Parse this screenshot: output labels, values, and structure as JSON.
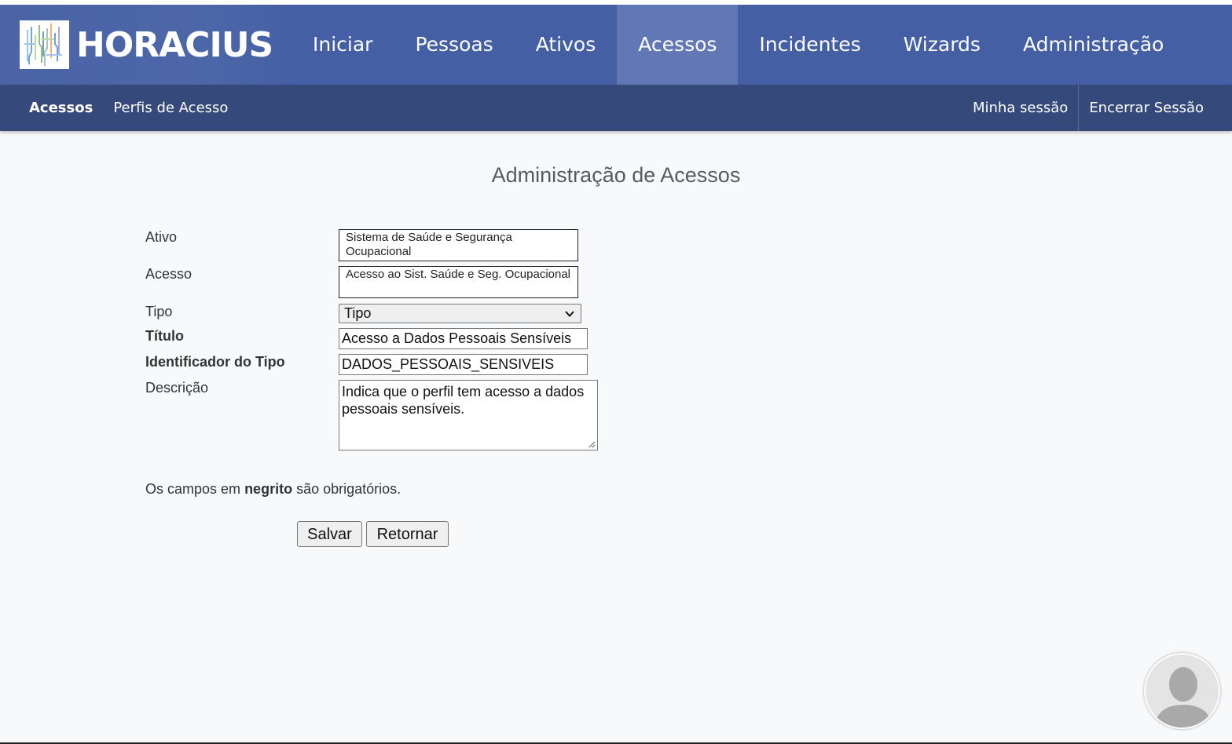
{
  "app": {
    "brand": "HORACIUS"
  },
  "nav": {
    "items": [
      {
        "label": "Iniciar"
      },
      {
        "label": "Pessoas"
      },
      {
        "label": "Ativos"
      },
      {
        "label": "Acessos"
      },
      {
        "label": "Incidentes"
      },
      {
        "label": "Wizards"
      },
      {
        "label": "Administração"
      }
    ],
    "active": "Acessos"
  },
  "subnav": {
    "left": [
      {
        "label": "Acessos"
      },
      {
        "label": "Perfis de Acesso"
      }
    ],
    "right": [
      {
        "label": "Minha sessão"
      },
      {
        "label": "Encerrar Sessão"
      }
    ]
  },
  "page": {
    "title": "Administração de Acessos"
  },
  "form": {
    "ativo_label": "Ativo",
    "ativo_value": "Sistema de Saúde e Segurança Ocupacional",
    "acesso_label": "Acesso",
    "acesso_value": "Acesso ao Sist. Saúde e Seg. Ocupacional",
    "tipo_label": "Tipo",
    "tipo_value": "Tipo",
    "titulo_label": "Título",
    "titulo_value": "Acesso a Dados Pessoais Sensíveis",
    "identificador_label": "Identificador do Tipo",
    "identificador_value": "DADOS_PESSOAIS_SENSIVEIS",
    "descricao_label": "Descrição",
    "descricao_value": "Indica que o perfil tem acesso a dados pessoais sensíveis.",
    "note_prefix": "Os campos em",
    "note_bold": "negrito",
    "note_suffix": "são obrigatórios.",
    "save_label": "Salvar",
    "return_label": "Retornar"
  },
  "colors": {
    "header": "#445fa3",
    "nav_active": "#6277b5",
    "subnav": "#36497b",
    "background": "#f7f9fb"
  },
  "icons": {
    "logo": "horacius-logo-icon",
    "avatar": "user-avatar-icon",
    "select_arrow": "chevron-down-icon"
  }
}
